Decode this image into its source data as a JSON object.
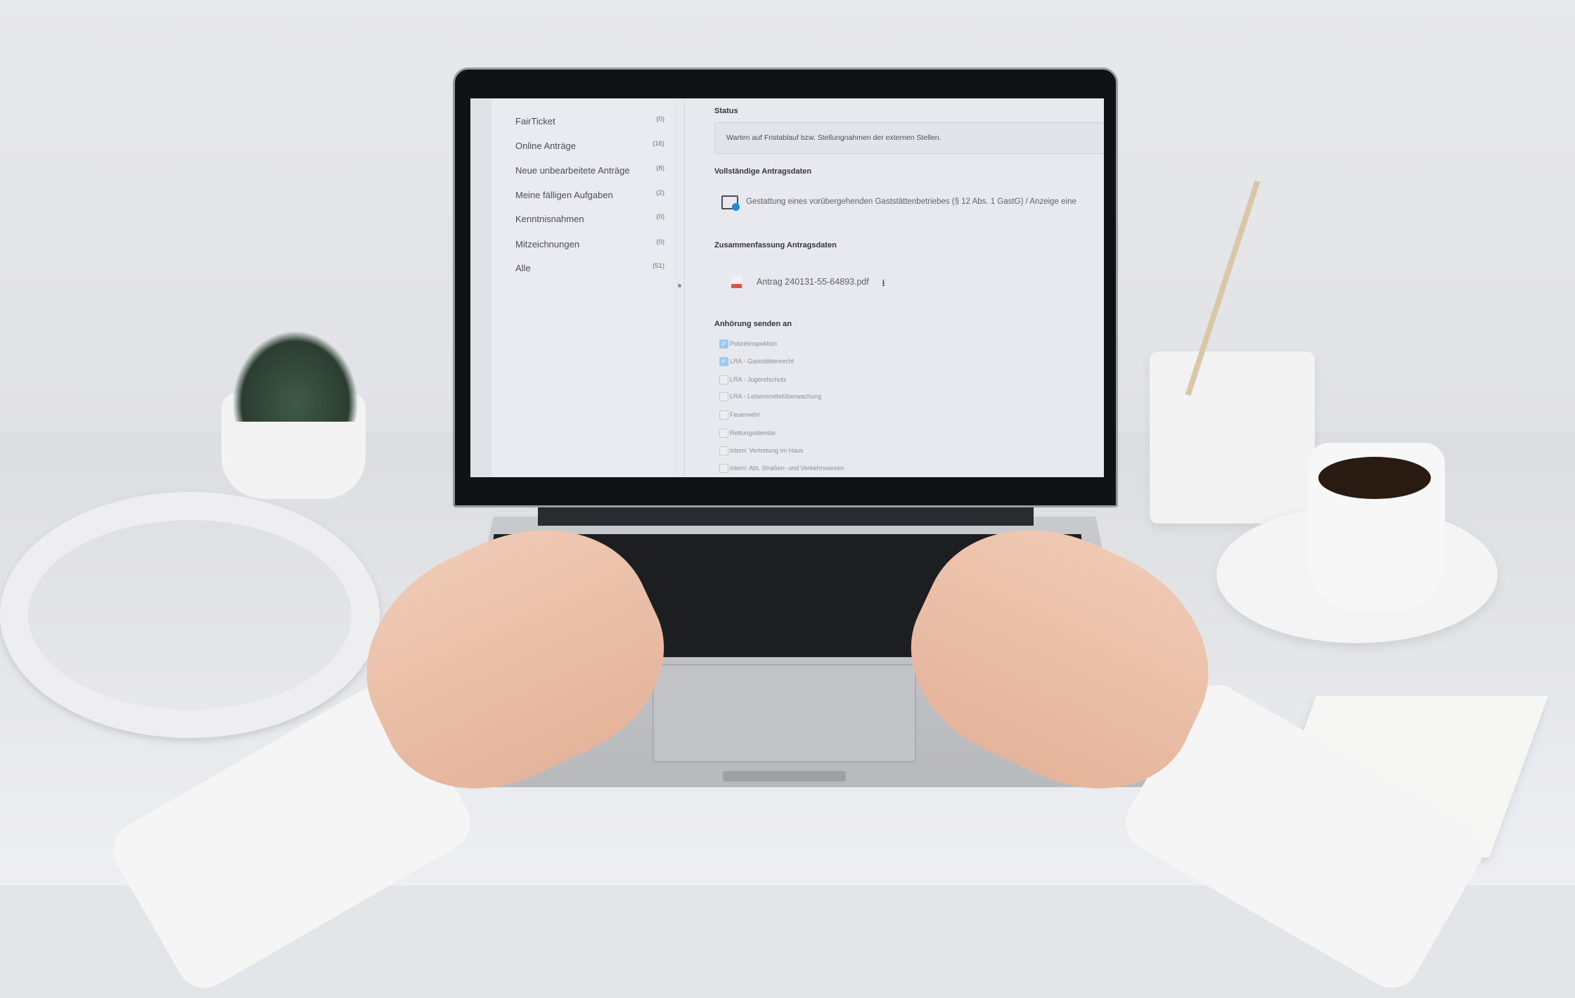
{
  "sidebar": {
    "items": [
      {
        "label": "FairTicket",
        "count": "(0)"
      },
      {
        "label": "Online Anträge",
        "count": "(16)"
      },
      {
        "label": "Neue unbearbeitete Anträge",
        "count": "(8)"
      },
      {
        "label": "Meine fälligen Aufgaben",
        "count": "(2)"
      },
      {
        "label": "Kenntnisnahmen",
        "count": "(0)"
      },
      {
        "label": "Mitzeichnungen",
        "count": "(0)"
      },
      {
        "label": "Alle",
        "count": "(51)"
      }
    ]
  },
  "main": {
    "status": {
      "label": "Status",
      "text": "Warten auf Fristablauf bzw. Stellungnahmen der externen Stellen."
    },
    "full_data": {
      "label": "Vollständige Antragsdaten",
      "item": "Gestattung eines vorübergehenden Gaststättenbetriebes (§ 12 Abs. 1 GastG) / Anzeige eine",
      "icon": "folder-icon"
    },
    "summary": {
      "label": "Zusammenfassung Antragsdaten",
      "file": "Antrag 240131-55-64893.pdf",
      "icon": "pdf-icon"
    },
    "hearing": {
      "label": "Anhörung senden an",
      "options": [
        {
          "label": "Polizeiinspektion",
          "checked": true
        },
        {
          "label": "LRA - Gaststättenrecht",
          "checked": true
        },
        {
          "label": "LRA - Jugendschutz",
          "checked": false
        },
        {
          "label": "LRA - Lebensmittelüberwachung",
          "checked": false
        },
        {
          "label": "Feuerwehr",
          "checked": false
        },
        {
          "label": "Rettungsdienste",
          "checked": false
        },
        {
          "label": "intern: Vertretung im Haus",
          "checked": false
        },
        {
          "label": "intern: Abt. Straßen- und Verkehrswesen",
          "checked": false
        }
      ]
    }
  },
  "colors": {
    "accent": "#1e88e5",
    "checkbox_checked": "#9ccbee"
  }
}
